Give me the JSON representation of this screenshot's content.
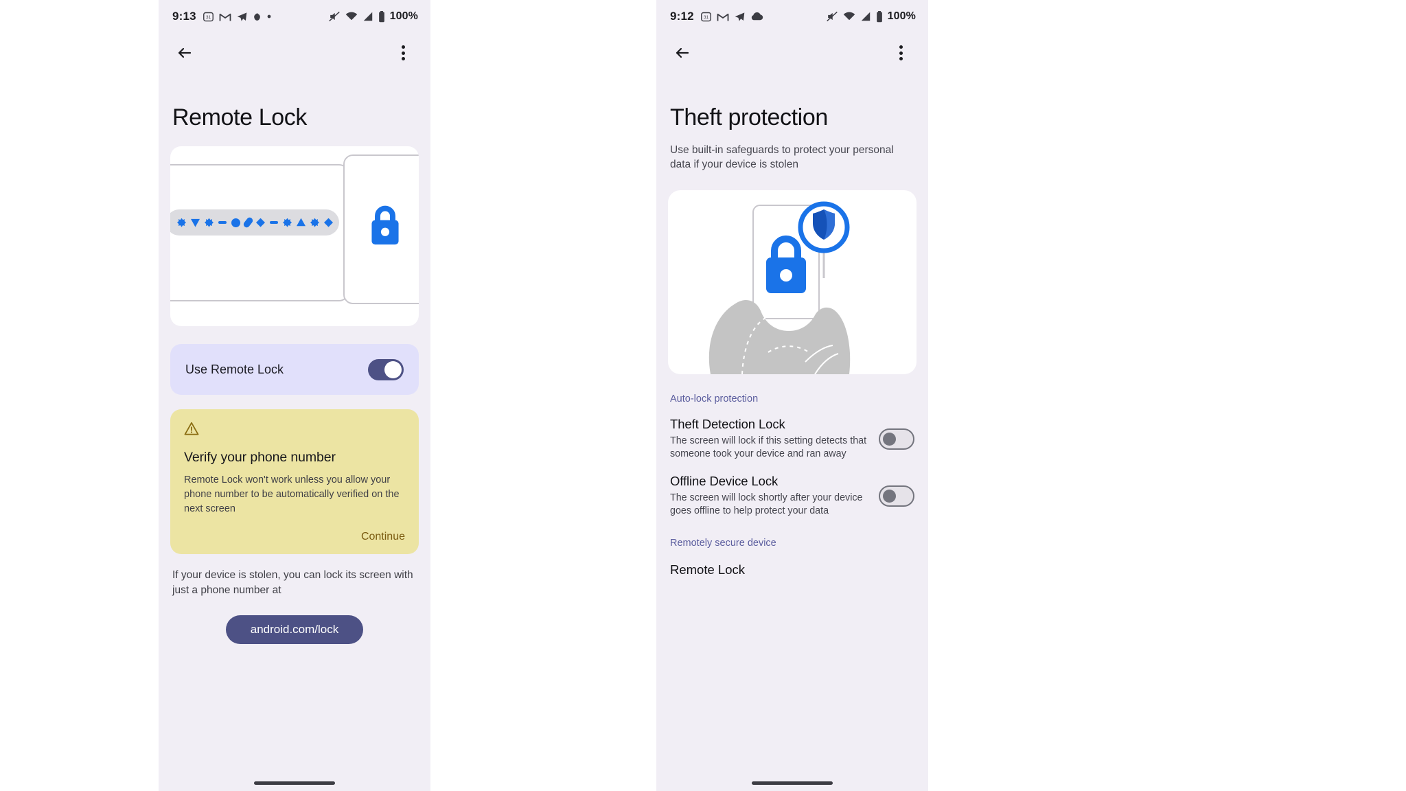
{
  "left_phone": {
    "status_bar": {
      "time": "9:13",
      "battery_text": "100%",
      "left_icons": [
        "calendar-icon",
        "gmail-icon",
        "telegram-icon",
        "app-icon",
        "dot-icon"
      ],
      "right_icons": [
        "mute-icon",
        "wifi-icon",
        "signal-icon",
        "battery-icon"
      ]
    },
    "app_bar": {
      "back": "back-arrow-icon",
      "overflow": "overflow-menu-icon"
    },
    "title": "Remote Lock",
    "illustration": {
      "name": "remote-lock-illustration",
      "pin_shapes": [
        "flower",
        "triangle-down",
        "flower",
        "dash",
        "circle",
        "pill",
        "diamond",
        "dash",
        "flower",
        "triangle-up",
        "flower",
        "diamond"
      ],
      "lock_color": "#1a73e8"
    },
    "toggle_row": {
      "label": "Use Remote Lock",
      "state": "on",
      "track_color": "#4d5185"
    },
    "warning_card": {
      "icon": "warning-triangle-icon",
      "title": "Verify your phone number",
      "body": "Remote Lock won't work unless you allow your phone number to be automatically verified on the next screen",
      "action": "Continue",
      "background_color": "#ece4a3",
      "action_color": "#7a5b10"
    },
    "footer_note": "If your device is stolen, you can lock its screen with just a phone number at",
    "footer_button": "android.com/lock"
  },
  "right_phone": {
    "status_bar": {
      "time": "9:12",
      "battery_text": "100%",
      "left_icons": [
        "calendar-icon",
        "gmail-icon",
        "telegram-icon",
        "cloud-icon"
      ],
      "right_icons": [
        "mute-icon",
        "wifi-icon",
        "signal-icon",
        "battery-icon"
      ]
    },
    "app_bar": {
      "back": "back-arrow-icon",
      "overflow": "overflow-menu-icon"
    },
    "title": "Theft protection",
    "subtitle": "Use built-in safeguards to protect your personal data if your device is stolen",
    "illustration": {
      "name": "theft-protection-illustration",
      "lock_color": "#1a73e8",
      "shield_color": "#1552b8",
      "hand_color": "#c4c4c4"
    },
    "sections": [
      {
        "header": "Auto-lock protection",
        "items": [
          {
            "title": "Theft Detection Lock",
            "subtitle": "The screen will lock if this setting detects that someone took your device and ran away",
            "state": "off"
          },
          {
            "title": "Offline Device Lock",
            "subtitle": "The screen will lock shortly after your device goes offline to help protect your data",
            "state": "off"
          }
        ]
      },
      {
        "header": "Remotely secure device",
        "items": [
          {
            "title": "Remote Lock",
            "subtitle": "",
            "state": "none"
          }
        ]
      }
    ],
    "section_header_color": "#5b5d9e"
  }
}
